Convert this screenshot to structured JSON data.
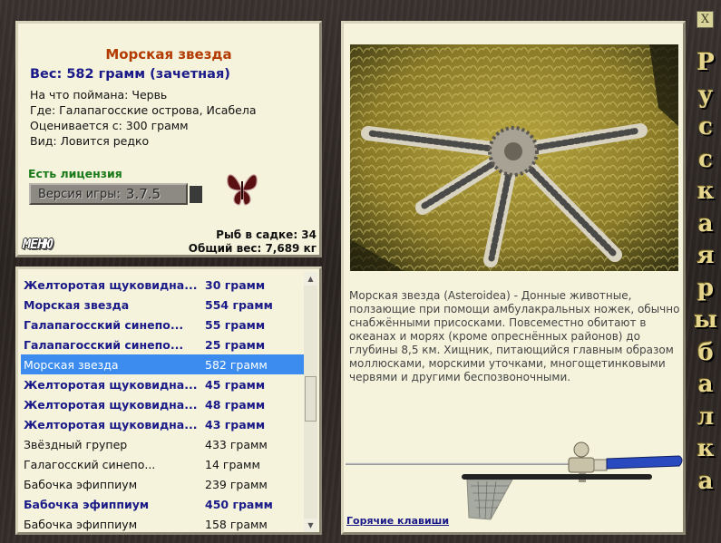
{
  "info": {
    "title": "Морская звезда",
    "weight": "Вес: 582 грамм (зачетная)",
    "bait": "На что поймана: Червь",
    "location": "Где: Галапагосские острова, Исабела",
    "valued_from": "Оценивается с: 300 грамм",
    "rarity": "Вид: Ловится редко",
    "license": "Есть лицензия",
    "version_label": "Версия игры:",
    "version_value": "3.7.5",
    "menu_label": "МЕНЮ",
    "fish_in_cage": "Рыб в садке: 34",
    "total_weight": "Общий вес: 7,689 кг"
  },
  "fish_list": [
    {
      "name": "Желторотая щуковидна...",
      "weight": "30 грамм",
      "style": "b"
    },
    {
      "name": "Морская звезда",
      "weight": "554 грамм",
      "style": "b"
    },
    {
      "name": "Галапагосский синепо...",
      "weight": "55 грамм",
      "style": "b"
    },
    {
      "name": "Галапагосский синепо...",
      "weight": "25 грамм",
      "style": "b"
    },
    {
      "name": "Морская звезда",
      "weight": "582 грамм",
      "style": "s"
    },
    {
      "name": "Желторотая щуковидна...",
      "weight": "45 грамм",
      "style": "b"
    },
    {
      "name": "Желторотая щуковидна...",
      "weight": "48 грамм",
      "style": "b"
    },
    {
      "name": "Желторотая щуковидна...",
      "weight": "43 грамм",
      "style": "b"
    },
    {
      "name": "Звёздный групер",
      "weight": "433 грамм",
      "style": "p"
    },
    {
      "name": "Галагосский синепо...",
      "weight": "14 грамм",
      "style": "p"
    },
    {
      "name": "Бабочка эфиппиум",
      "weight": "239 грамм",
      "style": "p"
    },
    {
      "name": "Бабочка эфиппиум",
      "weight": "450 грамм",
      "style": "b"
    },
    {
      "name": "Бабочка эфиппиум",
      "weight": "158 грамм",
      "style": "p"
    }
  ],
  "description": "Морская звезда (Asteroidea) - Донные животные, ползающие при помощи амбулакральных ножек, обычно снабжёнными присосками. Повсеместно обитают в океанах и морях (кроме опреснённых районов) до глубины 8,5 км. Хищник, питающийся главным образом моллюсками, морскими уточками, многощетинковыми червями и другими беспозвоночными.",
  "hotkeys": "Горячие клавиши",
  "close_label": "X",
  "vertical_title": "Русская рыбалка",
  "icons": {
    "butterfly": "butterfly-icon",
    "photo": "starfish-photo",
    "rod": "fishing-rod-icon",
    "net": "landing-net-icon"
  },
  "colors": {
    "title": "#b33a00",
    "weight_blue": "#1a1a88",
    "license_green": "#1a7a1a",
    "selection": "#3c8cf0",
    "panel_bg": "#f5f3dc"
  }
}
